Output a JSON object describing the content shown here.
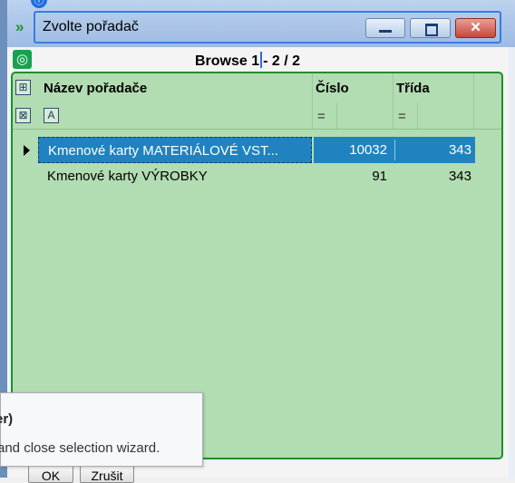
{
  "window": {
    "title": "Zvolte pořadač",
    "close_glyph": "✕",
    "top_marker_glyph": "ⓘ"
  },
  "toolbar": {
    "nav_glyph": "◎",
    "browse_prefix": "Browse",
    "browse_position": "1",
    "browse_suffix": "- 2 / 2"
  },
  "grid": {
    "columns": [
      {
        "label": "Název pořadače",
        "filter_op": ""
      },
      {
        "label": "Číslo",
        "filter_op": "="
      },
      {
        "label": "Třída",
        "filter_op": "="
      }
    ],
    "tool_icons": {
      "column_chooser": "⊞",
      "filter_clear": "⊠",
      "text_filter": "A"
    },
    "rows": [
      {
        "name": "Kmenové karty MATERIÁLOVÉ VST...",
        "number": "10032",
        "class": "343",
        "selected": true
      },
      {
        "name": "Kmenové karty VÝROBKY",
        "number": "91",
        "class": "343",
        "selected": false
      }
    ]
  },
  "tooltip": {
    "title": "er)",
    "body": "and close selection wizard."
  },
  "buttons": {
    "ok": "OK",
    "cancel": "Zrušit"
  },
  "colors": {
    "grid_background": "#b2dcb1",
    "grid_border": "#1f8f2b",
    "selection": "#2083bf",
    "title_focus": "#3b7de0"
  },
  "icons": {
    "app": "double-chevron-icon",
    "nav": "target-icon",
    "minimize": "minimize-icon",
    "maximize": "maximize-icon",
    "close": "close-icon"
  }
}
